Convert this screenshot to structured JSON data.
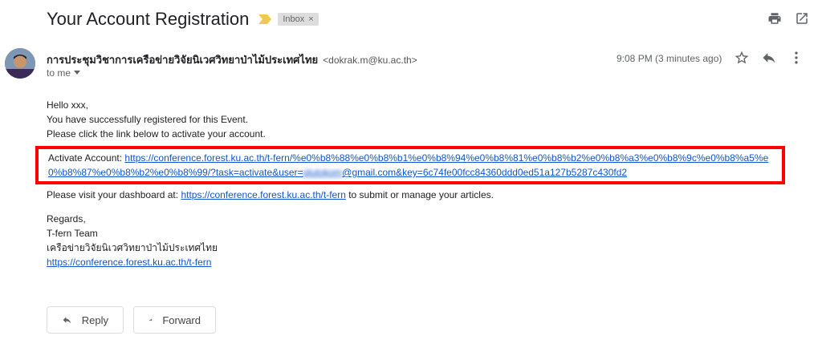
{
  "subject": "Your Account Registration",
  "label_badge": "Inbox",
  "label_badge_close": "×",
  "sender": {
    "name": "การประชุมวิชาการเครือข่ายวิจัยนิเวศวิทยาป่าไม้ประเทศไทย",
    "email": "<dokrak.m@ku.ac.th>",
    "to": "to me",
    "time": "9:08 PM (3 minutes ago)"
  },
  "body": {
    "greeting": "Hello xxx,",
    "line1": "You have successfully registered for this Event.",
    "line2": "Please click the link below to activate your account.",
    "activate_label": "Activate Account: ",
    "activate_link_part1": "https://conference.forest.ku.ac.th/t-fern/%e0%b8%88%e0%b8%b1%e0%b8%94%e0%b8%81%e0%b8%b2%e0%b8%a3%e0%b8%9c%e0%b8%a5%e0%b8%87%e0%b8%b2%e0%b8%99/?task=activate&user=",
    "activate_link_blurred": "plutokom",
    "activate_link_part2": "@gmail.com&key=6c74fe00fcc84360ddd0ed51a127b5287c430fd2",
    "dashboard_prefix": "Please visit your dashboard at: ",
    "dashboard_link": "https://conference.forest.ku.ac.th/t-fern",
    "dashboard_suffix": " to submit or manage your articles.",
    "regards": "Regards,",
    "team": "T-fern Team",
    "network": "เครือข่ายวิจัยนิเวศวิทยาป่าไม้ประเทศไทย",
    "footer_link": "https://conference.forest.ku.ac.th/t-fern"
  },
  "actions": {
    "reply": "Reply",
    "forward": "Forward"
  },
  "colors": {
    "link": "#1155cc",
    "highlight_border": "#ff0000",
    "importance_marker": "#f2c94c"
  }
}
